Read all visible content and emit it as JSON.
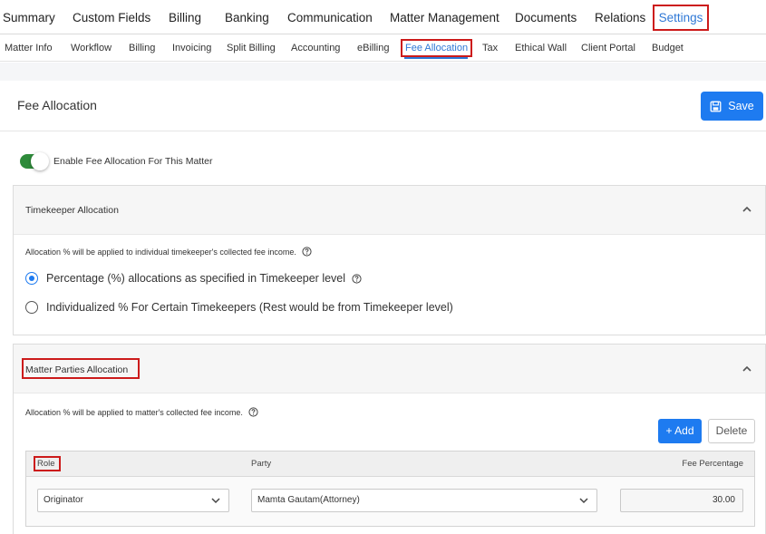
{
  "top_tabs": [
    "Summary",
    "Custom Fields",
    "Billing",
    "Banking",
    "Communication",
    "Matter Management",
    "Documents",
    "Relations",
    "Settings"
  ],
  "sub_tabs": [
    "Matter Info",
    "Workflow",
    "Billing",
    "Invoicing",
    "Split Billing",
    "Accounting",
    "eBilling",
    "Fee Allocation",
    "Tax",
    "Ethical Wall",
    "Client Portal",
    "Budget"
  ],
  "header": {
    "title": "Fee Allocation",
    "save_label": "Save"
  },
  "toggle": {
    "label": "Enable Fee Allocation For This Matter",
    "enabled": true
  },
  "timekeeper": {
    "title": "Timekeeper Allocation",
    "note": "Allocation % will be applied to individual timekeeper's collected fee income.",
    "options": [
      {
        "label": "Percentage (%) allocations as specified in Timekeeper level",
        "checked": true
      },
      {
        "label": "Individualized % For Certain Timekeepers (Rest would be from Timekeeper level)",
        "checked": false
      }
    ]
  },
  "matter_parties": {
    "title": "Matter Parties Allocation",
    "note": "Allocation % will be applied to matter's collected fee income.",
    "add_label": "+ Add",
    "delete_label": "Delete",
    "columns": [
      "Role",
      "Party",
      "Fee Percentage"
    ],
    "rows": [
      {
        "role": "Originator",
        "party": "Mamta Gautam(Attorney)",
        "fee_percentage": "30.00"
      }
    ]
  },
  "colors": {
    "accent": "#1e7bf0",
    "highlight": "#cc1b1b",
    "toggle_on": "#2e8b3a"
  }
}
